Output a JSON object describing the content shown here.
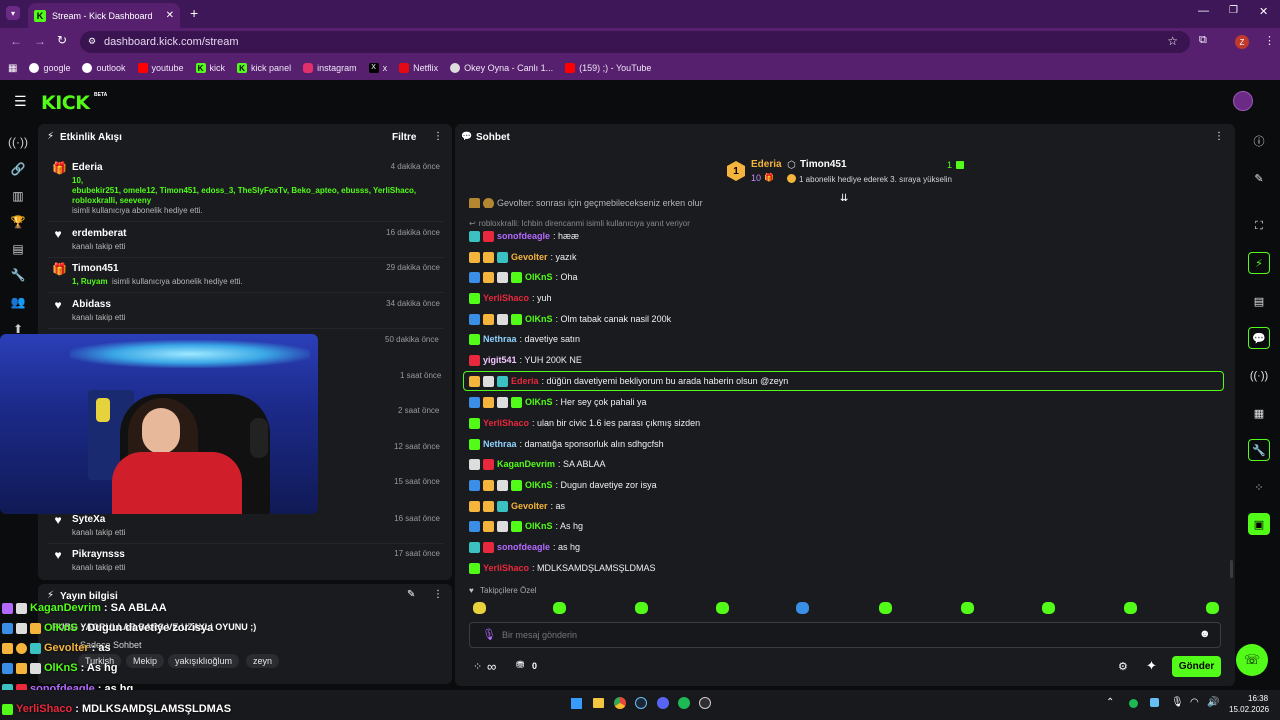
{
  "browser": {
    "tab_title": "Stream - Kick Dashboard",
    "url": "dashboard.kick.com/stream",
    "profile_initial": "Z",
    "bookmarks": [
      {
        "label": "google",
        "color": "#ffffff"
      },
      {
        "label": "outlook",
        "color": "#ffffff"
      },
      {
        "label": "youtube",
        "color": "#ff0000"
      },
      {
        "label": "kick",
        "color": "#53fc18"
      },
      {
        "label": "kick panel",
        "color": "#53fc18"
      },
      {
        "label": "instagram",
        "color": "#e1306c"
      },
      {
        "label": "x",
        "color": "#000000"
      },
      {
        "label": "Netflix",
        "color": "#e50914"
      },
      {
        "label": "Okey Oyna - Canlı 1...",
        "color": "#ffffff"
      },
      {
        "label": "(159) ;) - YouTube",
        "color": "#ff0000"
      }
    ]
  },
  "kick": {
    "logo": "KICK",
    "logo_badge": "BETA"
  },
  "activity": {
    "title": "Etkinlik Akışı",
    "filter_label": "Filtre",
    "items": [
      {
        "name": "Ederia",
        "time": "4 dakika önce",
        "icon": "gift-icon",
        "detail_green": "10,",
        "detail_green2": "ebubekir251, omele12, Timon451, edoss_3, TheSlyFoxTv, Beko_apteo, ebusss, YerliShaco,",
        "detail_green3": "robloxkralli, seeveny",
        "detail": "isimli kullanıcıya abonelik hediye etti."
      },
      {
        "name": "erdemberat",
        "time": "16 dakika önce",
        "icon": "heart-icon",
        "detail": "kanalı takip etti"
      },
      {
        "name": "Timon451",
        "time": "29 dakika önce",
        "icon": "gift-icon",
        "detail_green": "1, Ruyam",
        "detail": "isimli kullanıcıya abonelik hediye etti."
      },
      {
        "name": "Abidass",
        "time": "34 dakika önce",
        "icon": "heart-icon",
        "detail": "kanalı takip etti"
      },
      {
        "name": "",
        "time": "50 dakika önce",
        "icon": "",
        "detail": ""
      },
      {
        "name": "",
        "time": "1 saat önce",
        "icon": "",
        "detail": ""
      },
      {
        "name": "",
        "time": "2 saat önce",
        "icon": "",
        "detail": ""
      },
      {
        "name": "",
        "time": "12 saat önce",
        "icon": "",
        "detail": ""
      },
      {
        "name": "",
        "time": "15 saat önce",
        "icon": "",
        "detail": ""
      },
      {
        "name": "SyteXa",
        "time": "16 saat önce",
        "icon": "heart-icon",
        "detail": "kanalı takip etti"
      },
      {
        "name": "Pikraynsss",
        "time": "17 saat önce",
        "icon": "heart-icon",
        "detail": "kanalı takip etti"
      }
    ]
  },
  "stream_info": {
    "title": "Yayın bilgisi",
    "stream_title": "PUBG YAORULLAR BARS VE UZAYLI OYUNU ;)",
    "chat_mode": "Sadece Sohbet",
    "tags": [
      "Turkish",
      "Mekip",
      "yakışıklıoğlum",
      "zeyn"
    ]
  },
  "chat": {
    "title": "Sohbet",
    "pinned": {
      "leader_name": "Ederia",
      "leader_count": "10",
      "second_name": "Timon451",
      "second_count": "1",
      "notice": "1 abonelik hediye ederek 3. sıraya yükselin"
    },
    "partial_line": "Gevolter: sonrası için geçmebilecekseniz erken olur",
    "reply_note": "robloxkralli: Ichbin direncanmi isimli kullanıcıya yanıt veriyor",
    "messages": [
      {
        "user": "sonofdeagle",
        "text": ": hææ",
        "color": "#b469ff"
      },
      {
        "user": "Gevolter",
        "text": ": yazık",
        "color": "#f5b43b"
      },
      {
        "user": "OlKnS",
        "text": ": Oha",
        "color": "#53fc18"
      },
      {
        "user": "YerliShaco",
        "text": ": yuh",
        "color": "#e8283c"
      },
      {
        "user": "OlKnS",
        "text": ": Olm tabak canak nasil 200k",
        "color": "#53fc18"
      },
      {
        "user": "Nethraa",
        "text": ": davetiye satın",
        "color": "#8fd3ff"
      },
      {
        "user": "yigit541",
        "text": ": YUH 200K NE",
        "color": "#f3c5ff"
      },
      {
        "user": "Ederia",
        "text": ": düğün davetiyemi bekliyorum bu arada haberin olsun @zeyn",
        "color": "#e8283c"
      },
      {
        "user": "OlKnS",
        "text": ": Her sey çok pahali ya",
        "color": "#53fc18"
      },
      {
        "user": "YerliShaco",
        "text": ": ulan bir civic 1.6 ies parası çıkmış sizden",
        "color": "#e8283c"
      },
      {
        "user": "Nethraa",
        "text": ": damatığa sponsorluk alın sdhgcfsh",
        "color": "#8fd3ff"
      },
      {
        "user": "KaganDevrim",
        "text": ": SA ABLAA",
        "color": "#53fc18"
      },
      {
        "user": "OlKnS",
        "text": ": Dugun davetiye zor isya",
        "color": "#53fc18"
      },
      {
        "user": "Gevolter",
        "text": ": as",
        "color": "#f5b43b"
      },
      {
        "user": "OlKnS",
        "text": ": As hg",
        "color": "#53fc18"
      },
      {
        "user": "sonofdeagle",
        "text": ": as hg",
        "color": "#b469ff"
      },
      {
        "user": "YerliShaco",
        "text": ": MDLKSAMDŞLAMSŞLDMAS",
        "color": "#e8283c"
      }
    ],
    "followers_only": "Takipçilere Özel",
    "input_placeholder": "Bir mesaj gönderin",
    "infinity_label": "∞",
    "points": "0",
    "send_label": "Gönder"
  },
  "overlay": {
    "lines": [
      {
        "user": "KaganDevrim",
        "text": ": SA ABLAA",
        "color": "#53fc18"
      },
      {
        "user": "OlKnS",
        "text": ": Dugun davetiye zor isya",
        "color": "#53fc18"
      },
      {
        "user": "Gevolter",
        "text": ": as",
        "color": "#f5b43b"
      },
      {
        "user": "OlKnS",
        "text": ": As hg",
        "color": "#53fc18"
      },
      {
        "user": "sonofdeagle",
        "text": ": as hg",
        "color": "#b469ff"
      },
      {
        "user": "YerliShaco",
        "text": ": MDLKSAMDŞLAMSŞLDMAS",
        "color": "#e8283c"
      }
    ]
  },
  "taskbar": {
    "time": "16:38",
    "date": "15.02.2026"
  }
}
